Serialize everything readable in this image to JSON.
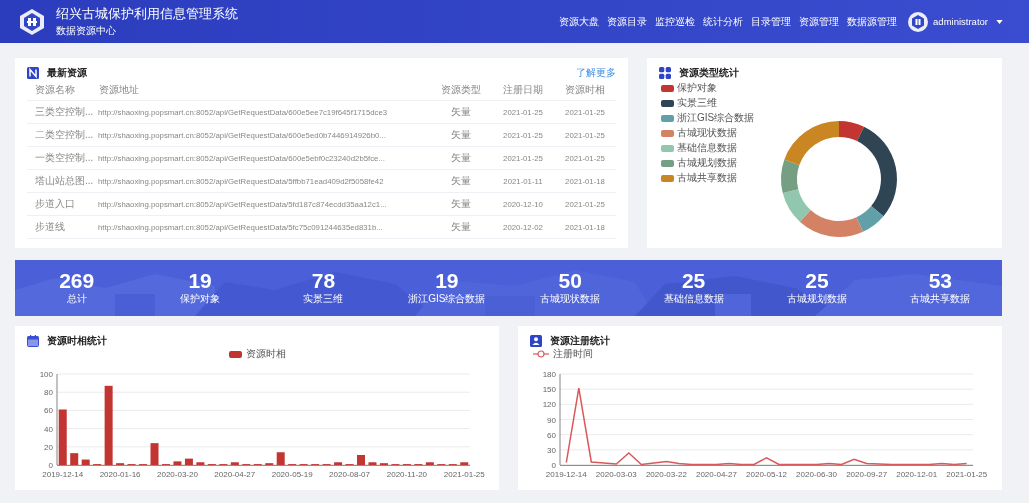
{
  "header": {
    "title": "绍兴古城保护利用信息管理系统",
    "subtitle": "数据资源中心",
    "nav": [
      "资源大盘",
      "资源目录",
      "监控巡检",
      "统计分析",
      "目录管理",
      "资源管理",
      "数据源管理"
    ],
    "user": "administrator"
  },
  "latest": {
    "title": "最新资源",
    "more": "了解更多",
    "columns": [
      "资源名称",
      "资源地址",
      "资源类型",
      "注册日期",
      "资源时相"
    ],
    "rows": [
      [
        "三类空控制...",
        "http://shaoxing.popsmart.cn:8052/api/GetRequestData/600e5ee7c19f645f1715dce3",
        "矢量",
        "2021-01-25",
        "2021-01-25"
      ],
      [
        "二类空控制...",
        "http://shaoxing.popsmart.cn:8052/api/GetRequestData/600e5ed0b7446914926b0...",
        "矢量",
        "2021-01-25",
        "2021-01-25"
      ],
      [
        "一类空控制...",
        "http://shaoxing.popsmart.cn:8052/api/GetRequestData/600e5ebf0c23240d2b5fce...",
        "矢量",
        "2021-01-25",
        "2021-01-25"
      ],
      [
        "塔山站总图...",
        "http://shaoxing.popsmart.cn:8052/api/GetRequestData/5ffbb71ead409d2f5058fe42",
        "矢量",
        "2021-01-11",
        "2021-01-18"
      ],
      [
        "步道入口",
        "http://shaoxing.popsmart.cn:8052/api/GetRequestData/5fd187c874ecdd35aa12c1...",
        "矢量",
        "2020-12-10",
        "2021-01-25"
      ],
      [
        "步道线",
        "http://shaoxing.popsmart.cn:8052/api/GetRequestData/5fc75c091244635ed831b...",
        "矢量",
        "2020-12-02",
        "2021-01-18"
      ]
    ]
  },
  "type_stats": {
    "title": "资源类型统计",
    "chart_data": {
      "type": "donut",
      "legend": "top-left",
      "categories": [
        "保护对象",
        "实景三维",
        "浙江GIS综合数据",
        "古城现状数据",
        "基础信息数据",
        "古城规划数据",
        "古城共享数据"
      ],
      "values": [
        7.1,
        29.0,
        7.1,
        18.6,
        9.3,
        9.3,
        19.6
      ],
      "colors": [
        "#c23531",
        "#2f4554",
        "#61a0a8",
        "#d48265",
        "#91c7ae",
        "#749f83",
        "#ca8622"
      ]
    }
  },
  "stats": [
    {
      "value": "269",
      "label": "总计"
    },
    {
      "value": "19",
      "label": "保护对象"
    },
    {
      "value": "78",
      "label": "实景三维"
    },
    {
      "value": "19",
      "label": "浙江GIS综合数据"
    },
    {
      "value": "50",
      "label": "古城现状数据"
    },
    {
      "value": "25",
      "label": "基础信息数据"
    },
    {
      "value": "25",
      "label": "古城规划数据"
    },
    {
      "value": "53",
      "label": "古城共享数据"
    }
  ],
  "phase_stats": {
    "title": "资源时相统计",
    "chart_data": {
      "type": "bar",
      "legend": "top",
      "grid": true,
      "categories": [
        "2019-12-14",
        null,
        null,
        null,
        null,
        "2020-01-16",
        null,
        null,
        null,
        null,
        "2020-03-20",
        null,
        null,
        null,
        null,
        "2020-04-27",
        null,
        null,
        null,
        null,
        "2020-05-19",
        null,
        null,
        null,
        null,
        "2020-08-07",
        null,
        null,
        null,
        null,
        "2020-11-20",
        null,
        null,
        null,
        null,
        "2021-01-25"
      ],
      "series": [
        {
          "name": "资源时相",
          "color": "#c23531",
          "values": [
            61,
            13,
            6,
            1,
            87,
            2,
            1,
            1,
            24,
            1,
            4,
            7,
            3,
            1,
            1,
            3,
            1,
            1,
            2,
            14,
            1,
            1,
            1,
            1,
            3,
            1,
            11,
            3,
            2,
            1,
            1,
            1,
            3,
            1,
            1,
            3
          ]
        }
      ],
      "ylim": [
        0,
        100
      ],
      "yticks": [
        0,
        20,
        40,
        60,
        80,
        100
      ]
    }
  },
  "register_stats": {
    "title": "资源注册统计",
    "chart_data": {
      "type": "line",
      "grid": true,
      "categories": [
        "2019-12-14",
        null,
        null,
        null,
        "2020-03-03",
        null,
        null,
        null,
        "2020-03-22",
        null,
        null,
        null,
        "2020-04-27",
        null,
        null,
        null,
        "2020-05-12",
        null,
        null,
        null,
        "2020-06-30",
        null,
        null,
        null,
        "2020-09-27",
        null,
        null,
        null,
        "2020-12-01",
        null,
        null,
        null,
        "2021-01-25"
      ],
      "series": [
        {
          "name": "注册时间",
          "color": "#d9585a",
          "values": [
            5,
            152,
            6,
            4,
            2,
            24,
            1,
            4,
            7,
            3,
            1,
            1,
            1,
            3,
            1,
            1,
            14,
            1,
            1,
            1,
            1,
            3,
            1,
            11,
            3,
            2,
            1,
            1,
            1,
            1,
            3,
            1,
            3
          ]
        }
      ],
      "ylim": [
        0,
        180
      ],
      "yticks": [
        0,
        30,
        60,
        90,
        120,
        150,
        180
      ]
    }
  }
}
